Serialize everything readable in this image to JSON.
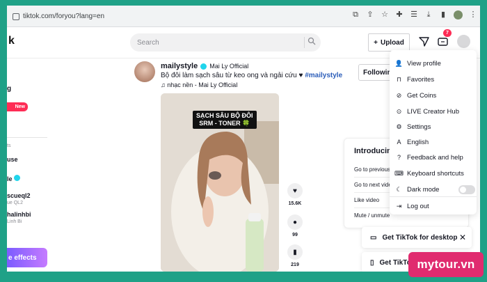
{
  "browser": {
    "url": "tiktok.com/foryou?lang=en"
  },
  "header": {
    "search_placeholder": "Search",
    "upload_label": "Upload",
    "inbox_badge": "7"
  },
  "sidebar": {
    "fragments": [
      "g",
      "New",
      "ts",
      "use",
      "le",
      "scueql2",
      "ue QL2",
      "halinhbi",
      "Linh Bi"
    ],
    "effects_label": "e effects"
  },
  "post": {
    "username": "mailystyle",
    "nickname": "Mai Ly Official",
    "caption_text": "Bộ đôi làm sạch sâu từ keo ong và ngải cứu ♥ ",
    "hashtag": "#mailystyle",
    "music": "nhạc nền - Mai Ly Official",
    "video_overlay_line1": "SẠCH SÂU BỘ ĐÔI",
    "video_overlay_line2": "SRM - TONER 🍀",
    "likes": "15.6K",
    "comments": "99",
    "saves": "219",
    "following_label": "Followin"
  },
  "keyboard_card": {
    "title": "Introducing",
    "rows": [
      "Go to previous",
      "Go to next vide",
      "Like video",
      "Mute / unmute"
    ]
  },
  "get_tiktok": {
    "desktop_label": "Get TikTok for desktop",
    "app_label": "Get TikTo"
  },
  "menu": {
    "items": [
      {
        "label": "View profile",
        "icon": "user-icon"
      },
      {
        "label": "Favorites",
        "icon": "bookmark-icon"
      },
      {
        "label": "Get Coins",
        "icon": "coin-icon"
      },
      {
        "label": "LIVE Creator Hub",
        "icon": "live-icon"
      },
      {
        "label": "Settings",
        "icon": "gear-icon"
      },
      {
        "label": "English",
        "icon": "language-icon"
      },
      {
        "label": "Feedback and help",
        "icon": "help-icon"
      },
      {
        "label": "Keyboard shortcuts",
        "icon": "keyboard-icon"
      },
      {
        "label": "Dark mode",
        "icon": "moon-icon"
      },
      {
        "label": "Log out",
        "icon": "logout-icon"
      }
    ]
  },
  "watermark": "mytour.vn",
  "colors": {
    "frame": "#1fa187",
    "accent": "#fe2c55",
    "hashtag": "#2b5db9",
    "watermark": "#e02b6f"
  }
}
